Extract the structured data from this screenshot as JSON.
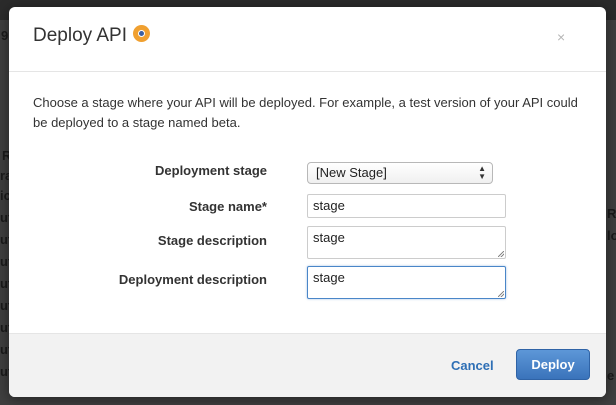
{
  "background": {
    "fragments": [
      "9",
      "R",
      "ra",
      "ic",
      "ut",
      "ut",
      "ut",
      "ut",
      "ut",
      "ut",
      "ut",
      "ut",
      "R",
      "lo",
      "e"
    ]
  },
  "modal": {
    "title": "Deploy API",
    "title_icon": "info-circle-icon",
    "close_glyph": "×",
    "intro_text": "Choose a stage where your API will be deployed. For example, a test version of your API could be deployed to a stage named beta.",
    "form": {
      "deployment_stage_label": "Deployment stage",
      "deployment_stage_value": "[New Stage]",
      "stage_name_label": "Stage name*",
      "stage_name_value": "stage",
      "stage_description_label": "Stage description",
      "stage_description_value": "stage",
      "deployment_description_label": "Deployment description",
      "deployment_description_value": "stage"
    },
    "footer": {
      "cancel_label": "Cancel",
      "deploy_label": "Deploy"
    }
  },
  "colors": {
    "accent_orange": "#f0a030",
    "primary_button": "#3a73bb",
    "link_blue": "#2e6fb5"
  }
}
